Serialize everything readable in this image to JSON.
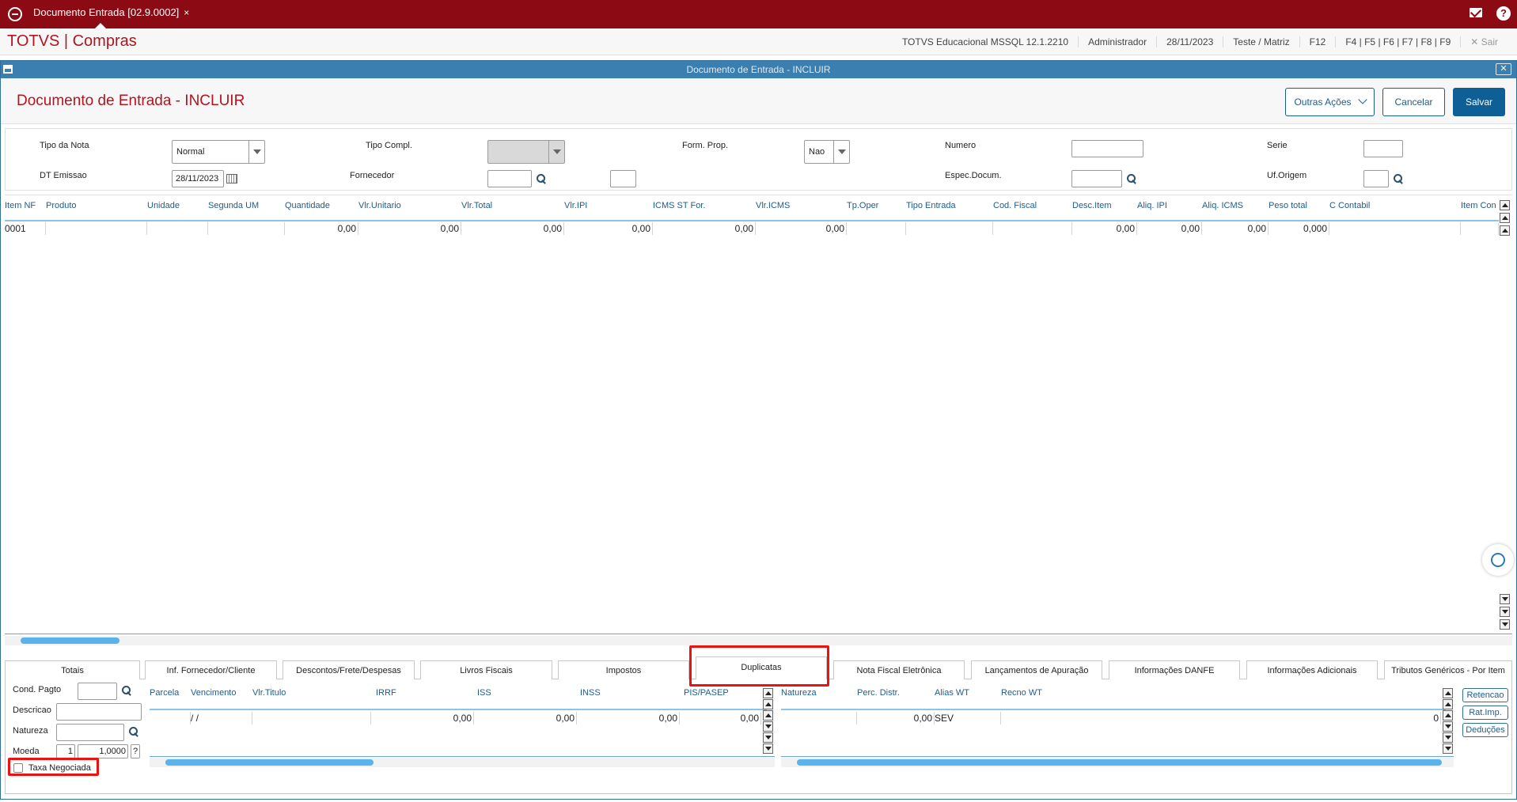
{
  "topbar": {
    "tab_label": "Documento Entrada [02.9.0002]",
    "tab_close": "×"
  },
  "header": {
    "brand": "TOTVS | Compras",
    "environment": "TOTVS Educacional MSSQL 12.1.2210",
    "user": "Administrador",
    "date": "28/11/2023",
    "branch": "Teste / Matriz",
    "f12": "F12",
    "fkeys": "F4 | F5 | F6 | F7 | F8 | F9",
    "exit": "Sair"
  },
  "window": {
    "title": "Documento de Entrada - INCLUIR",
    "close": "✕"
  },
  "page": {
    "title": "Documento de Entrada - INCLUIR",
    "actions": {
      "more": "Outras Ações",
      "cancel": "Cancelar",
      "save": "Salvar"
    }
  },
  "form": {
    "tipo_nota_label": "Tipo da Nota",
    "tipo_nota_value": "Normal",
    "tipo_compl_label": "Tipo Compl.",
    "tipo_compl_value": "",
    "form_prop_label": "Form. Prop.",
    "form_prop_value": "Nao",
    "numero_label": "Numero",
    "numero_value": "",
    "serie_label": "Serie",
    "serie_value": "",
    "dt_emissao_label": "DT Emissao",
    "dt_emissao_value": "28/11/2023",
    "fornecedor_label": "Fornecedor",
    "fornecedor_value": "",
    "fornecedor_loja": "",
    "espec_label": "Espec.Docum.",
    "espec_value": "",
    "uf_label": "Uf.Origem",
    "uf_value": ""
  },
  "items_grid": {
    "headers": [
      "Item NF",
      "Produto",
      "Unidade",
      "Segunda UM",
      "Quantidade",
      "Vlr.Unitario",
      "Vlr.Total",
      "Vlr.IPI",
      "ICMS ST For.",
      "Vlr.ICMS",
      "Tp.Oper",
      "Tipo Entrada",
      "Cod. Fiscal",
      "Desc.Item",
      "Aliq. IPI",
      "Aliq. ICMS",
      "Peso total",
      "C Contabil",
      "Item Con"
    ],
    "row": [
      "0001",
      "",
      "",
      "",
      "0,00",
      "0,00",
      "0,00",
      "0,00",
      "0,00",
      "0,00",
      "",
      "",
      "",
      "0,00",
      "0,00",
      "0,00",
      "0,000",
      "",
      ""
    ]
  },
  "tabs": [
    "Totais",
    "Inf. Fornecedor/Cliente",
    "Descontos/Frete/Despesas",
    "Livros Fiscais",
    "Impostos",
    "Duplicatas",
    "Nota Fiscal Eletrônica",
    "Lançamentos de Apuração",
    "Informações DANFE",
    "Informações Adicionais",
    "Tributos Genéricos - Por Item"
  ],
  "active_tab": "Duplicatas",
  "duplicatas": {
    "cond_pagto_label": "Cond. Pagto",
    "cond_pagto_value": "",
    "descricao_label": "Descricao",
    "descricao_value": "",
    "natureza_label": "Natureza",
    "natureza_value": "",
    "moeda_label": "Moeda",
    "moeda_value": "1",
    "taxa_value": "1,0000",
    "help": "?",
    "taxa_negociada_label": "Taxa Negociada",
    "grid_headers": [
      "Parcela",
      "Vencimento",
      "Vlr.Titulo",
      "IRRF",
      "ISS",
      "INSS",
      "PIS/PASEP"
    ],
    "grid_row": [
      "",
      " /  /",
      "",
      "0,00",
      "0,00",
      "0,00",
      "0,00"
    ],
    "nat_headers": [
      "Natureza",
      "Perc. Distr.",
      "Alias WT",
      "Recno WT"
    ],
    "nat_row": [
      "",
      "0,00",
      "SEV",
      "0"
    ],
    "side_buttons": [
      "Retencao",
      "Rat.Imp.",
      "Deduções"
    ]
  },
  "colors": {
    "brand_red": "#8b0a14",
    "title_red": "#b3141e",
    "accent_blue": "#0f5f97",
    "highlight": "#e11111"
  }
}
